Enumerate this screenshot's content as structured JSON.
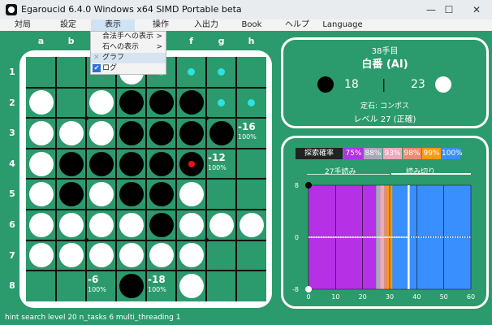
{
  "window": {
    "title": "Egaroucid 6.4.0 Windows x64 SIMD Portable beta",
    "controls": [
      "—",
      "☐",
      "✕"
    ]
  },
  "menu": [
    {
      "label": "対局"
    },
    {
      "label": "設定"
    },
    {
      "label": "表示"
    },
    {
      "label": "操作"
    },
    {
      "label": "入出力"
    },
    {
      "label": "Book"
    },
    {
      "label": "ヘルプ"
    },
    {
      "label": "Language"
    }
  ],
  "view_menu": {
    "items": [
      {
        "label": "合法手への表示",
        "arrow": ">"
      },
      {
        "label": "石への表示",
        "arrow": ">"
      },
      {
        "label": "グラフ",
        "checked": false
      },
      {
        "label": "ログ",
        "checked": true
      }
    ],
    "checkbox_off": "✕",
    "checkbox_on": "✔"
  },
  "board": {
    "col_labels": [
      "a",
      "b",
      "c",
      "d",
      "e",
      "f",
      "g",
      "h"
    ],
    "row_labels": [
      "1",
      "2",
      "3",
      "4",
      "5",
      "6",
      "7",
      "8"
    ],
    "cells": [
      "...W....",
      "W.WBBB..",
      "WWWBBBB.",
      "WBBBBB..",
      "WBWBBW..",
      "WWWWBWWW",
      "WWWWWW..",
      "...B.W.."
    ],
    "hint_cells": [
      "e1",
      "f1",
      "g1",
      "g2",
      "h2"
    ],
    "last_move": "f4",
    "evals": [
      {
        "cell": "h3",
        "value": "-16",
        "percent": "100%"
      },
      {
        "cell": "g4",
        "value": "-12",
        "percent": "100%"
      },
      {
        "cell": "c8",
        "value": "-6",
        "percent": "100%"
      },
      {
        "cell": "e8",
        "value": "-18",
        "percent": "100%"
      }
    ]
  },
  "info": {
    "move_number": "38手目",
    "turn": "白番 (AI)",
    "black_count": "18",
    "separator": "|",
    "white_count": "23",
    "opening": "定石: コンポス",
    "level": "レベル 27 (正確)"
  },
  "graph": {
    "legend_title": "探索確率",
    "legend": [
      {
        "label": "75%",
        "color": "#b630e6"
      },
      {
        "label": "88%",
        "color": "#a8a8b8"
      },
      {
        "label": "93%",
        "color": "#f3a7bd"
      },
      {
        "label": "98%",
        "color": "#ee8a6f"
      },
      {
        "label": "99%",
        "color": "#ff9a10"
      },
      {
        "label": "100%",
        "color": "#3a8fff"
      }
    ],
    "readahead_label": "27手読み",
    "endgame_label": "読み切り",
    "y_tick_labels": [
      "8",
      "0",
      "-8"
    ],
    "x_tick_labels": [
      "0",
      "10",
      "20",
      "30",
      "40",
      "50",
      "60"
    ]
  },
  "chart_data": {
    "type": "area",
    "title": "",
    "xlabel": "",
    "ylabel": "",
    "xlim": [
      0,
      60
    ],
    "ylim": [
      -8,
      8
    ],
    "x_ticks": [
      0,
      10,
      20,
      30,
      40,
      50,
      60
    ],
    "y_ticks": [
      8,
      0,
      -8
    ],
    "values": [
      {
        "x": 0,
        "y": 0
      },
      {
        "x": 37,
        "y": 0
      }
    ],
    "current_move": 37,
    "segments": [
      {
        "from": 0,
        "to": 25,
        "color": "#b630e6",
        "label": "75%"
      },
      {
        "from": 25,
        "to": 26.5,
        "color": "#a8a8b8",
        "label": "88%"
      },
      {
        "from": 26.5,
        "to": 28,
        "color": "#f3a7bd",
        "label": "93%"
      },
      {
        "from": 28,
        "to": 29,
        "color": "#ee8a6f",
        "label": "98%"
      },
      {
        "from": 29,
        "to": 31,
        "color": "#ff9a10",
        "label": "99%"
      },
      {
        "from": 31,
        "to": 60,
        "color": "#3a8fff",
        "label": "100%"
      }
    ]
  },
  "status": "hint search level 20 n_tasks 6 multi_threading 1"
}
